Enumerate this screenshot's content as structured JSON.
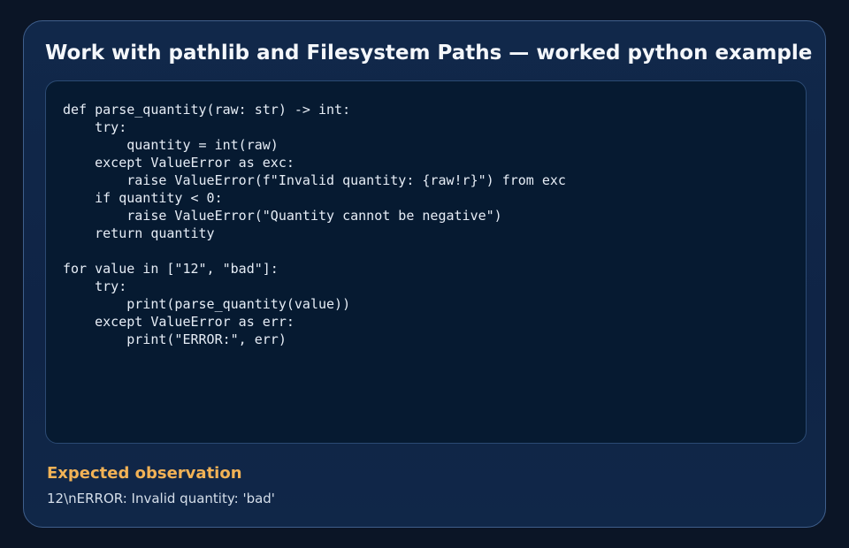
{
  "page": {
    "title": "Work with pathlib and Filesystem Paths — worked python example"
  },
  "code": {
    "language": "python",
    "source": "def parse_quantity(raw: str) -> int:\n    try:\n        quantity = int(raw)\n    except ValueError as exc:\n        raise ValueError(f\"Invalid quantity: {raw!r}\") from exc\n    if quantity < 0:\n        raise ValueError(\"Quantity cannot be negative\")\n    return quantity\n\nfor value in [\"12\", \"bad\"]:\n    try:\n        print(parse_quantity(value))\n    except ValueError as err:\n        print(\"ERROR:\", err)"
  },
  "observation": {
    "heading": "Expected observation",
    "text": "12\\nERROR: Invalid quantity: 'bad'"
  },
  "colors": {
    "background": "#0b1526",
    "card": "#11284a",
    "code_panel": "#061a31",
    "heading_accent": "#f2b256",
    "title": "#f4f7fb"
  }
}
